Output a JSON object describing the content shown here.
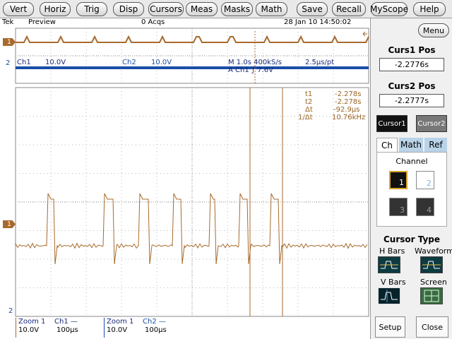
{
  "menu": [
    "Vert",
    "Horiz",
    "Trig",
    "Disp",
    "Cursors",
    "Meas",
    "Masks",
    "Math",
    "Save",
    "Recall",
    "MyScope",
    "Help"
  ],
  "status": {
    "brand": "Tek",
    "mode": "Preview",
    "acqs": "0 Acqs",
    "datetime": "28 Jan 10 14:50:02"
  },
  "overview": {
    "ch1_label": "Ch1",
    "ch1_scale": "10.0V",
    "ch2_label": "Ch2",
    "ch2_scale": "10.0V",
    "timebase": "M 1.0s 400kS/s",
    "resolution": "2.5μs/pt",
    "trigger": "A  Ch1  ∫  7.6V"
  },
  "cursor_readout": {
    "t1_label": "t1",
    "t1": "-2.278s",
    "t2_label": "t2",
    "t2": "-2.278s",
    "dt_label": "Δt",
    "dt": "-92.9μs",
    "inv_label": "1/Δt",
    "inv": "10.76kHz"
  },
  "markers": {
    "ch1": "1",
    "ch2": "2"
  },
  "bottom": [
    {
      "zoom": "Zoom 1",
      "ch": "Ch1 —",
      "v": "10.0V",
      "t": "100μs"
    },
    {
      "zoom": "Zoom 1",
      "ch": "Ch2 —",
      "v": "10.0V",
      "t": "100μs"
    }
  ],
  "panel": {
    "menu_label": "Menu",
    "curs1_title": "Curs1 Pos",
    "curs1_value": "-2.2776s",
    "curs2_title": "Curs2 Pos",
    "curs2_value": "-2.2777s",
    "cursor1_btn": "Cursor1",
    "cursor2_btn": "Cursor2",
    "tabs": [
      "Ch",
      "Math",
      "Ref"
    ],
    "channel_title": "Channel",
    "channels": [
      "1",
      "2",
      "3",
      "4"
    ],
    "cursor_type_title": "Cursor Type",
    "types": [
      "H Bars",
      "Waveform",
      "V Bars",
      "Screen"
    ],
    "setup": "Setup",
    "close": "Close"
  },
  "colors": {
    "ch1": "#a86a2c",
    "ch2": "#1a4ea8",
    "grid": "#b8b8b8",
    "panel_bg": "#f0f0f0"
  }
}
